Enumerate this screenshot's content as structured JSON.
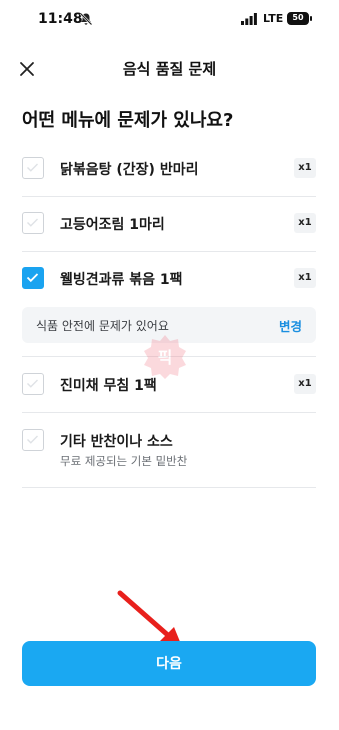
{
  "status_bar": {
    "time": "11:48",
    "network": "LTE",
    "battery": "50"
  },
  "header": {
    "title": "음식 품질 문제"
  },
  "question": "어떤 메뉴에 문제가 있나요?",
  "items": [
    {
      "label": "닭볶음탕 (간장) 반마리",
      "qty": "x1",
      "checked": false
    },
    {
      "label": "고등어조림 1마리",
      "qty": "x1",
      "checked": false
    },
    {
      "label": "웰빙견과류 볶음 1팩",
      "qty": "x1",
      "checked": true
    },
    {
      "label": "진미채 무침 1팩",
      "qty": "x1",
      "checked": false
    },
    {
      "label": "기타 반찬이나 소스",
      "sublabel": "무료 제공되는 기본 밑반찬",
      "checked": false
    }
  ],
  "issue": {
    "text": "식품 안전에 문제가 있어요",
    "change_label": "변경"
  },
  "watermark_text": "픽",
  "next_button": {
    "label": "다음"
  },
  "colors": {
    "accent": "#1aa8f2",
    "link": "#1a8fe0",
    "arrow": "#e8201c"
  }
}
